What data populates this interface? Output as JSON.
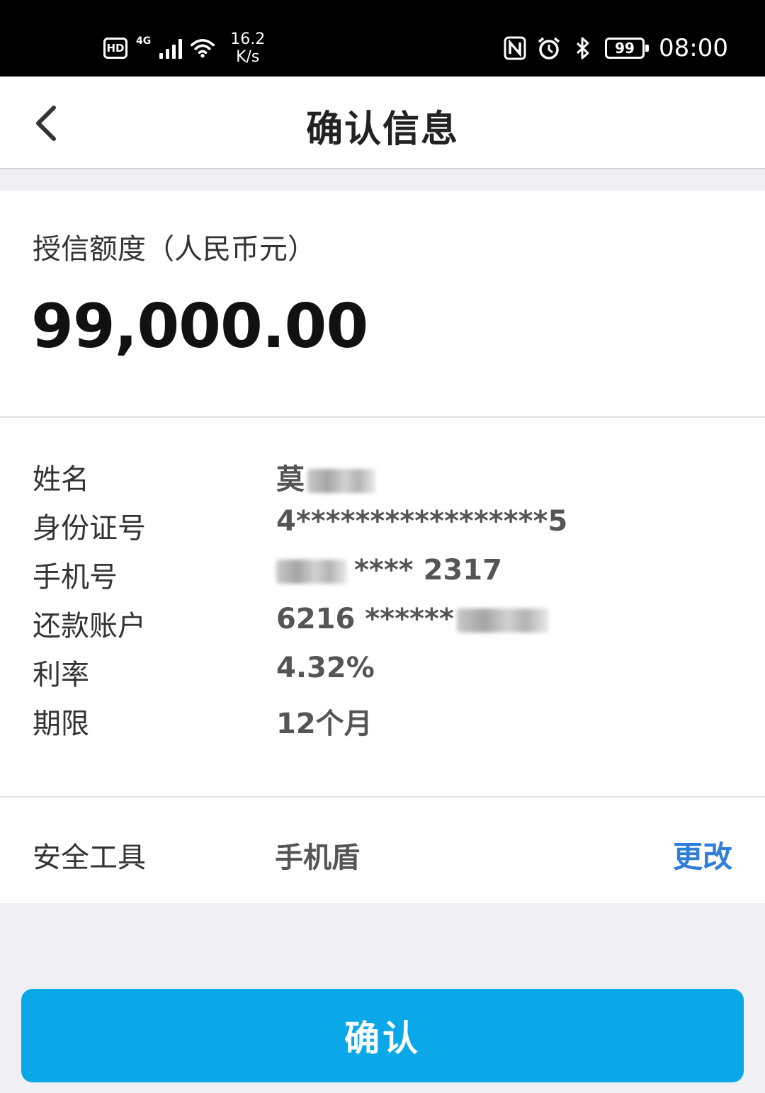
{
  "status_bar": {
    "hd": "HD",
    "network": "4G",
    "speed_value": "16.2",
    "speed_unit": "K/s",
    "battery": "99",
    "time": "08:00"
  },
  "nav": {
    "title": "确认信息"
  },
  "credit": {
    "label": "授信额度（人民币元）",
    "amount": "99,000.00"
  },
  "details": [
    {
      "label": "姓名",
      "value": "莫"
    },
    {
      "label": "身份证号",
      "value": "4*****************5"
    },
    {
      "label": "手机号",
      "value": "**** 2317"
    },
    {
      "label": "还款账户",
      "value": "6216 ******"
    },
    {
      "label": "利率",
      "value": "4.32%"
    },
    {
      "label": "期限",
      "value": "12个月"
    }
  ],
  "security_tool": {
    "label": "安全工具",
    "value": "手机盾",
    "change_label": "更改"
  },
  "confirm_button": {
    "label": "确认"
  },
  "colors": {
    "accent_blue": "#0aa8e8",
    "link_blue": "#2f7fd9",
    "page_bg": "#efeff4"
  }
}
